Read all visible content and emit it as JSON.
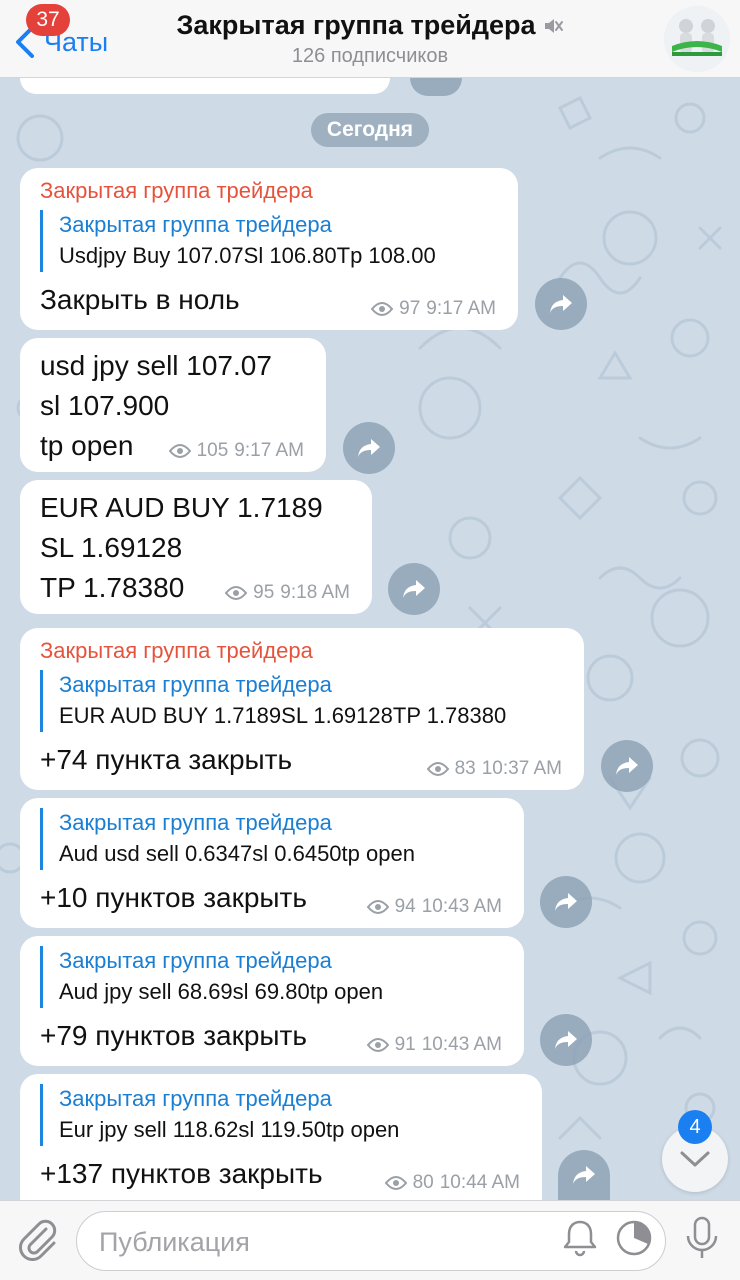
{
  "header": {
    "back_label": "Чаты",
    "unread_count": "37",
    "title": "Закрытая группа трейдера",
    "subtitle": "126 подписчиков"
  },
  "date_separator": "Сегодня",
  "messages": [
    {
      "sender": "Закрытая группа трейдера",
      "fwd_from": "Закрытая группа трейдера",
      "fwd_text": "Usdjpy Buy  107.07Sl 106.80Tp 108.00",
      "text": "Закрыть в ноль",
      "views": "97",
      "time": "9:17 AM"
    },
    {
      "text": "usd jpy sell 107.07\nsl 107.900\ntp open",
      "views": "105",
      "time": "9:17 AM"
    },
    {
      "text": "EUR AUD BUY 1.7189\nSL 1.69128\nTP 1.78380",
      "views": "95",
      "time": "9:18 AM"
    },
    {
      "sender": "Закрытая группа трейдера",
      "fwd_from": "Закрытая группа трейдера",
      "fwd_text": "EUR AUD BUY 1.7189SL 1.69128TP 1.78380",
      "text": "+74 пункта закрыть",
      "views": "83",
      "time": "10:37 AM"
    },
    {
      "fwd_from": "Закрытая группа трейдера",
      "fwd_text": "Aud usd sell 0.6347sl 0.6450tp open",
      "text": "+10 пунктов закрыть",
      "views": "94",
      "time": "10:43 AM"
    },
    {
      "fwd_from": "Закрытая группа трейдера",
      "fwd_text": "Aud jpy sell 68.69sl 69.80tp open",
      "text": "+79 пунктов закрыть",
      "views": "91",
      "time": "10:43 AM"
    },
    {
      "fwd_from": "Закрытая группа трейдера",
      "fwd_text": "Eur jpy sell 118.62sl 119.50tp open",
      "text": "+137 пунктов закрыть",
      "views": "80",
      "time": "10:44 AM"
    }
  ],
  "scroll_down_badge": "4",
  "composer": {
    "placeholder": "Публикация"
  },
  "colors": {
    "accent": "#1a7ff0",
    "sender": "#e5533d",
    "badge": "#e5413b",
    "chat_background": "#cedbe7"
  },
  "icons": [
    "back-chevron-icon",
    "mute-icon",
    "eye-icon",
    "share-icon",
    "chevron-down-icon",
    "paperclip-icon",
    "bell-icon",
    "timer-icon",
    "microphone-icon"
  ]
}
